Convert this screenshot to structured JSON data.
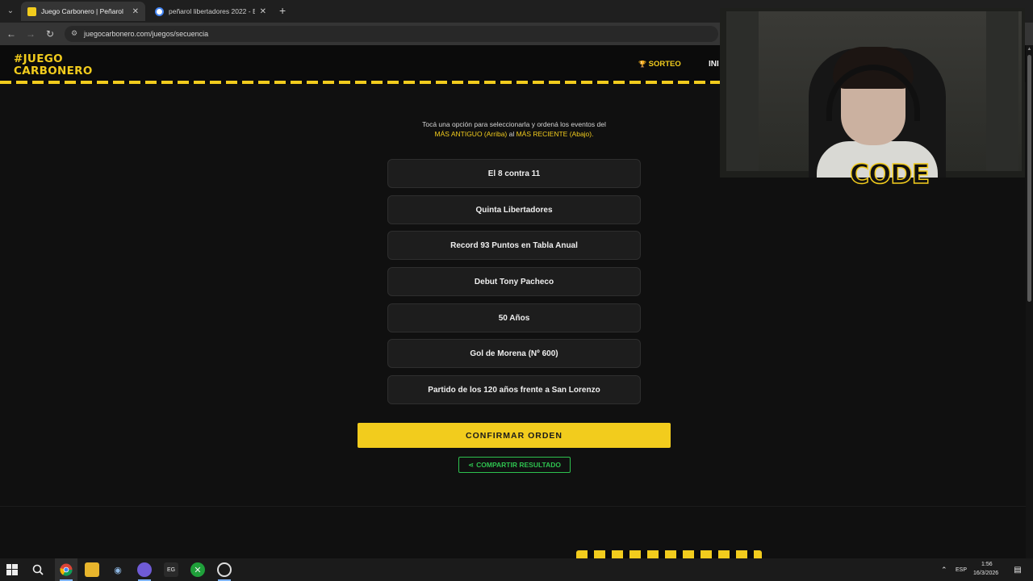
{
  "browser": {
    "tabs": [
      {
        "title": "Juego Carbonero | Peñarol",
        "active": true
      },
      {
        "title": "peñarol libertadores 2022 - Bus",
        "active": false
      }
    ],
    "url": "juegocarbonero.com/juegos/secuencia",
    "icons": {
      "back": "←",
      "forward": "→",
      "reload": "↻",
      "site_info": "⚙",
      "close": "✕",
      "new_tab": "+",
      "tab_list": "⌄"
    }
  },
  "site": {
    "logo_line1": "#JUEGO",
    "logo_line2": "CARBONERO",
    "nav_sorteo": "SORTEO",
    "nav_sorteo_icon": "🏆",
    "nav_inicio": "INI"
  },
  "game": {
    "instruction_line1": "Tocá una opción para seleccionarla y ordená los eventos del",
    "instruction_hl1": "MÁS ANTIGUO (Arriba)",
    "instruction_mid": " al ",
    "instruction_hl2": "MÁS RECIENTE (Abajo).",
    "options": [
      "El 8 contra 11",
      "Quinta Libertadores",
      "Record 93 Puntos en Tabla Anual",
      "Debut Tony Pacheco",
      "50 Años",
      "Gol de Morena (Nº 600)",
      "Partido de los 120 años frente a San Lorenzo"
    ],
    "confirm_label": "CONFIRMAR ORDEN",
    "share_label": "COMPARTIR RESULTADO",
    "share_icon": "⋖"
  },
  "webcam": {
    "badge": "CODE"
  },
  "taskbar": {
    "lang": "ESP",
    "time": "1:56",
    "date": "16/3/2026"
  },
  "colors": {
    "accent": "#f2cc1d",
    "share_green": "#2ec24f",
    "page_bg": "#101010"
  }
}
